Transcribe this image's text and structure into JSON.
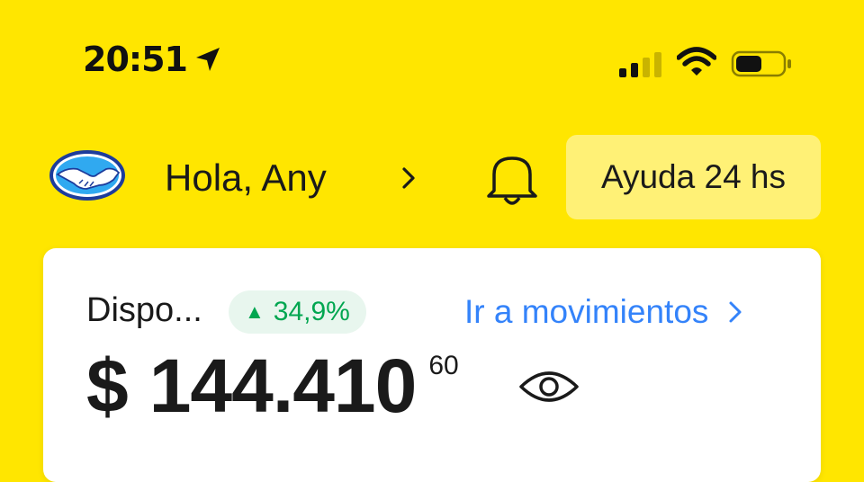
{
  "status_bar": {
    "time": "20:51",
    "location_icon": "location-arrow-icon",
    "signal_icon": "cellular-signal-icon",
    "wifi_icon": "wifi-icon",
    "battery_icon": "battery-icon"
  },
  "header": {
    "logo_icon": "mercado-pago-handshake-icon",
    "greeting": "Hola, Any",
    "chevron_icon": "chevron-right-icon",
    "notifications_icon": "bell-icon",
    "help_label": "Ayuda 24 hs"
  },
  "balance_card": {
    "label": "Dispo...",
    "change_arrow": "▲",
    "change_value": "34,9%",
    "movements_link": "Ir a movimientos",
    "currency_symbol": "$",
    "amount": "144.410",
    "cents": "60",
    "visibility_icon": "eye-icon"
  },
  "colors": {
    "background": "#FFE600",
    "help_button": "#FFF176",
    "link": "#3483FA",
    "positive": "#00A650",
    "positive_bg": "#E8F6EE",
    "card": "#FFFFFF"
  }
}
